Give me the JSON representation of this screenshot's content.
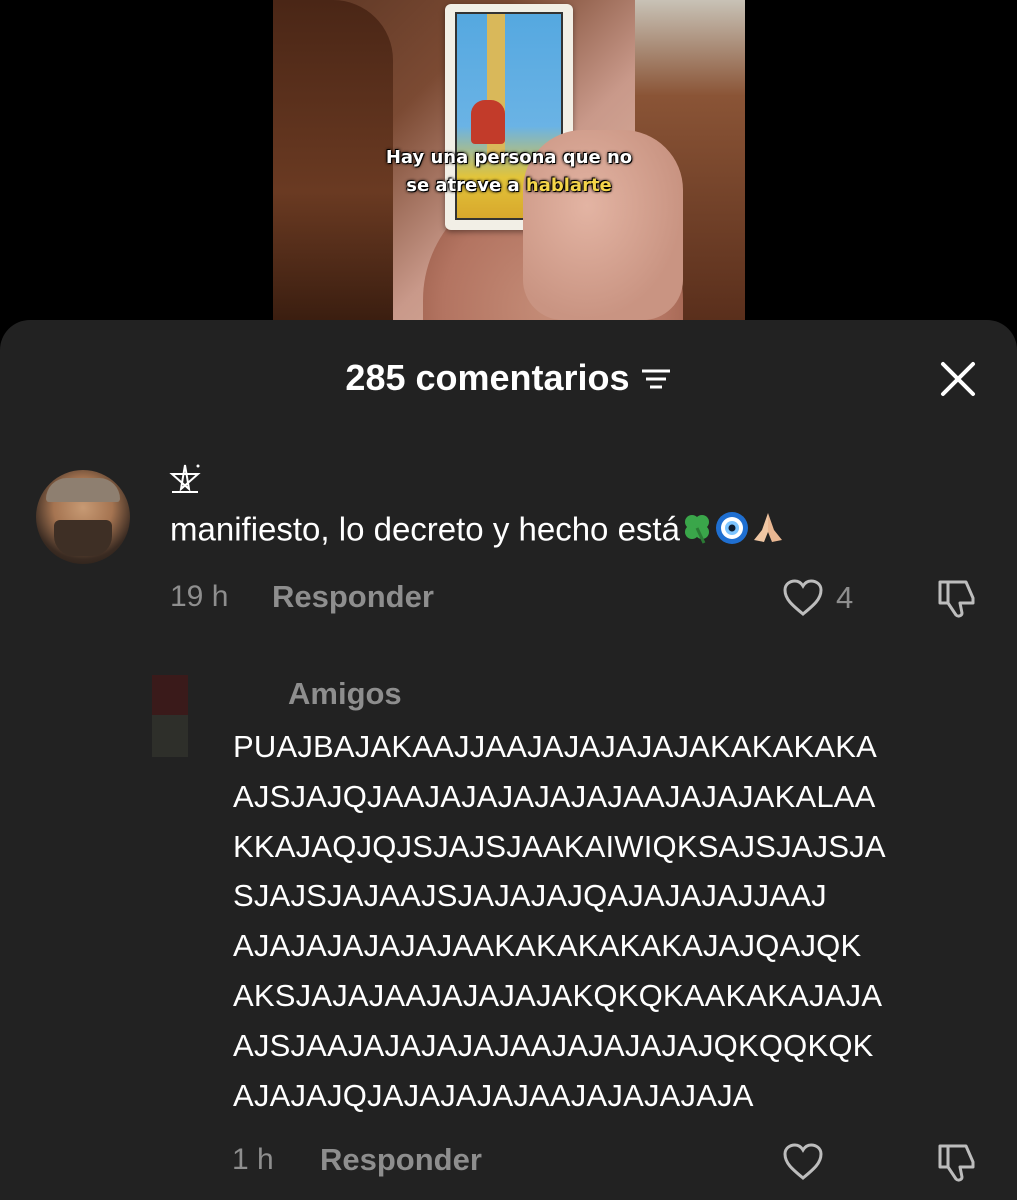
{
  "video": {
    "caption_line1": "Hay una persona que no",
    "caption_line2_prefix": "se atreve a",
    "caption_line2_highlight": "hablarte"
  },
  "sheet": {
    "title": "285 comentarios",
    "filter_icon": "filter-icon",
    "close_icon": "close-icon"
  },
  "comments": [
    {
      "badge_icon": "pentagram-icon",
      "text": "manifiesto, lo decreto y hecho está",
      "emojis": [
        "four-leaf-clover",
        "nazar-amulet",
        "folded-hands"
      ],
      "time": "19 h",
      "reply_label": "Responder",
      "likes": "4"
    }
  ],
  "reply": {
    "tag": "Amigos",
    "lines": [
      "PUAJBAJAKAAJJAAJAJAJAJAJAKAKAKAKA",
      "AJSJAJQJAAJAJAJAJAJAJAAJAJAJAKALAA",
      "KKAJAQJQJSJAJSJAAKAIWIQKSAJSJAJSJA",
      "SJAJSJAJAAJSJAJAJAJQAJAJAJAJJAAJ",
      "AJAJAJAJAJAJAAKAKAKAKAKAJAJQAJQK",
      "AKSJAJAJAAJAJAJAJAKQKQKAAKAKAJAJA",
      "AJSJAAJAJAJAJAJAAJAJAJAJAJQKQQKQK",
      "AJAJAJQJAJAJAJAJAAJAJAJAJAJA"
    ],
    "time": "1 h",
    "reply_label": "Responder"
  }
}
